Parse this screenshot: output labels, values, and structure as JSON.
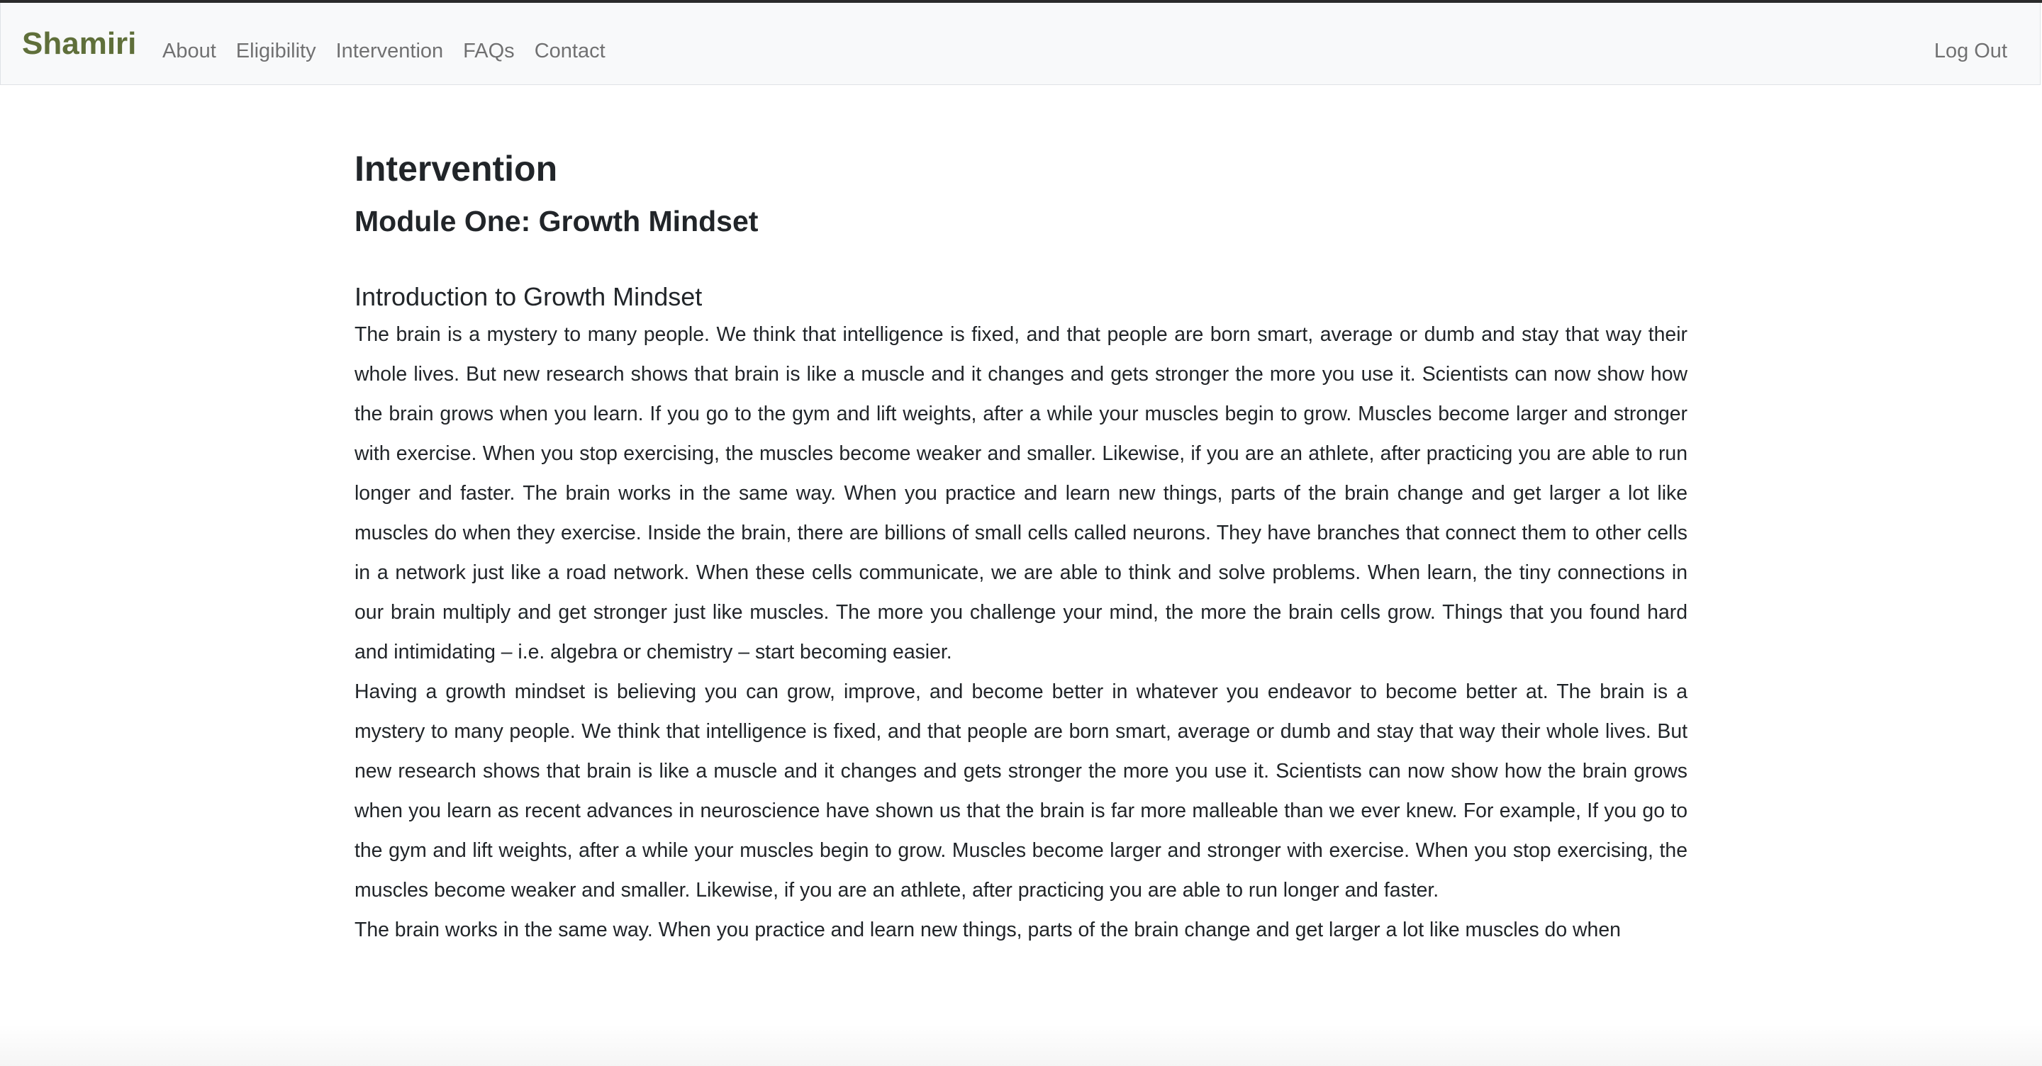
{
  "navbar": {
    "brand": "Shamiri",
    "links": [
      "About",
      "Eligibility",
      "Intervention",
      "FAQs",
      "Contact"
    ],
    "logout": "Log Out",
    "brand_color": "#5f6f3a"
  },
  "main": {
    "title": "Intervention",
    "module_title": "Module One: Growth Mindset",
    "section_title": "Introduction to Growth Mindset",
    "paragraphs": [
      "The brain is a mystery to many people. We think that intelligence is fixed, and that people are born smart, average or dumb and stay that way their whole lives. But new research shows that brain is like a muscle and it changes and gets stronger the more you use it. Scientists can now show how the brain grows when you learn. If you go to the gym and lift weights, after a while your muscles begin to grow. Muscles become larger and stronger with exercise. When you stop exercising, the muscles become weaker and smaller. Likewise, if you are an athlete, after practicing you are able to run longer and faster. The brain works in the same way. When you practice and learn new things, parts of the brain change and get larger a lot like muscles do when they exercise. Inside the brain, there are billions of small cells called neurons. They have branches that connect them to other cells in a network just like a road network. When these cells communicate, we are able to think and solve problems. When learn, the tiny connections in our brain multiply and get stronger just like muscles. The more you challenge your mind, the more the brain cells grow. Things that you found hard and intimidating – i.e. algebra or chemistry – start becoming easier.",
      "Having a growth mindset is believing you can grow, improve, and become better in whatever you endeavor to become better at. The brain is a mystery to many people. We think that intelligence is fixed, and that people are born smart, average or dumb and stay that way their whole lives. But new research shows that brain is like a muscle and it changes and gets stronger the more you use it. Scientists can now show how the brain grows when you learn as recent advances in neuroscience have shown us that the brain is far more malleable than we ever knew. For example, If you go to the gym and lift weights, after a while your muscles begin to grow. Muscles become larger and stronger with exercise. When you stop exercising, the muscles become weaker and smaller. Likewise, if you are an athlete, after practicing you are able to run longer and faster.",
      "The brain works in the same way. When you practice and learn new things, parts of the brain change and get larger a lot like muscles do when"
    ]
  }
}
